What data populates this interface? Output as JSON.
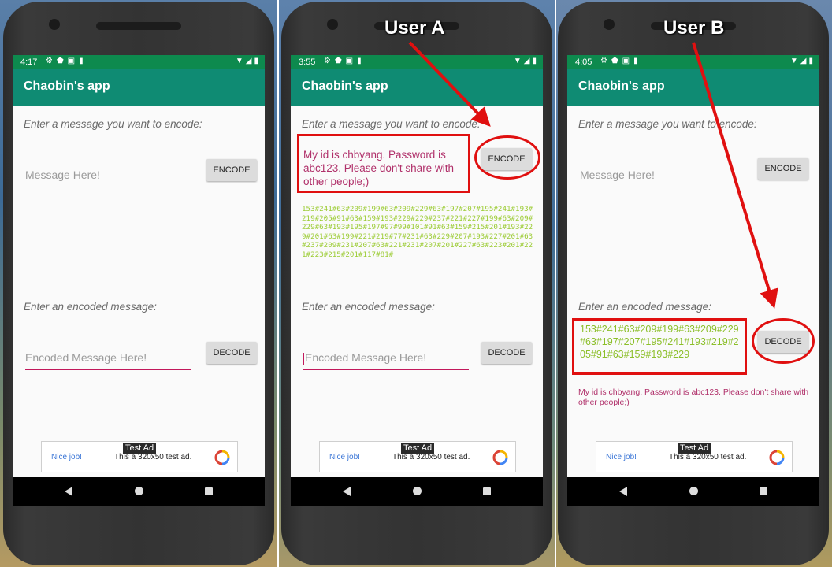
{
  "panels": [
    {
      "status_time": "4:17",
      "app_title": "Chaobin's app",
      "encode_label": "Enter a message you want to encode:",
      "message_placeholder": "Message Here!",
      "encode_button": "ENCODE",
      "decode_label": "Enter an encoded message:",
      "encoded_placeholder": "Encoded Message Here!",
      "decode_button": "DECODE",
      "ad": {
        "tag": "Test Ad",
        "nice": "Nice job!",
        "text": "This a 320x50 test ad."
      }
    },
    {
      "status_time": "3:55",
      "app_title": "Chaobin's app",
      "encode_label": "Enter a message you want to encode:",
      "message_value": "My id is chbyang. Password is abc123. Please don't share with other people;)",
      "encode_button": "ENCODE",
      "encoded_output": "153#241#63#209#199#63#209#229#63#197#207#195#241#193#219#205#91#63#159#193#229#229#237#221#227#199#63#209#229#63#193#195#197#97#99#101#91#63#159#215#201#193#229#201#63#199#221#219#77#231#63#229#207#193#227#201#63#237#209#231#207#63#221#231#207#201#227#63#223#201#221#223#215#201#117#81#",
      "decode_label": "Enter an encoded message:",
      "encoded_placeholder": "Encoded Message Here!",
      "decode_button": "DECODE",
      "ad": {
        "tag": "Test Ad",
        "nice": "Nice job!",
        "text": "This a 320x50 test ad."
      }
    },
    {
      "status_time": "4:05",
      "app_title": "Chaobin's app",
      "encode_label": "Enter a message you want to encode:",
      "message_placeholder": "Message Here!",
      "encode_button": "ENCODE",
      "decode_label": "Enter an encoded message:",
      "encoded_value": "153#241#63#209#199#63#209#229#63#197#207#195#241#193#219#205#91#63#159#193#229",
      "decode_button": "DECODE",
      "decoded_output": "My id is chbyang. Password is abc123. Please don't share with other people;)",
      "ad": {
        "tag": "Test Ad",
        "nice": "Nice job!",
        "text": "This a 320x50 test ad."
      }
    }
  ],
  "callouts": {
    "user_a": "User A",
    "user_b": "User B"
  },
  "colors": {
    "appbar": "#0f8b73",
    "statusbar": "#0d8a4e",
    "annotation_red": "#e01010",
    "encoded_text_green": "#9ccc34",
    "input_text_pink": "#b0306a"
  }
}
